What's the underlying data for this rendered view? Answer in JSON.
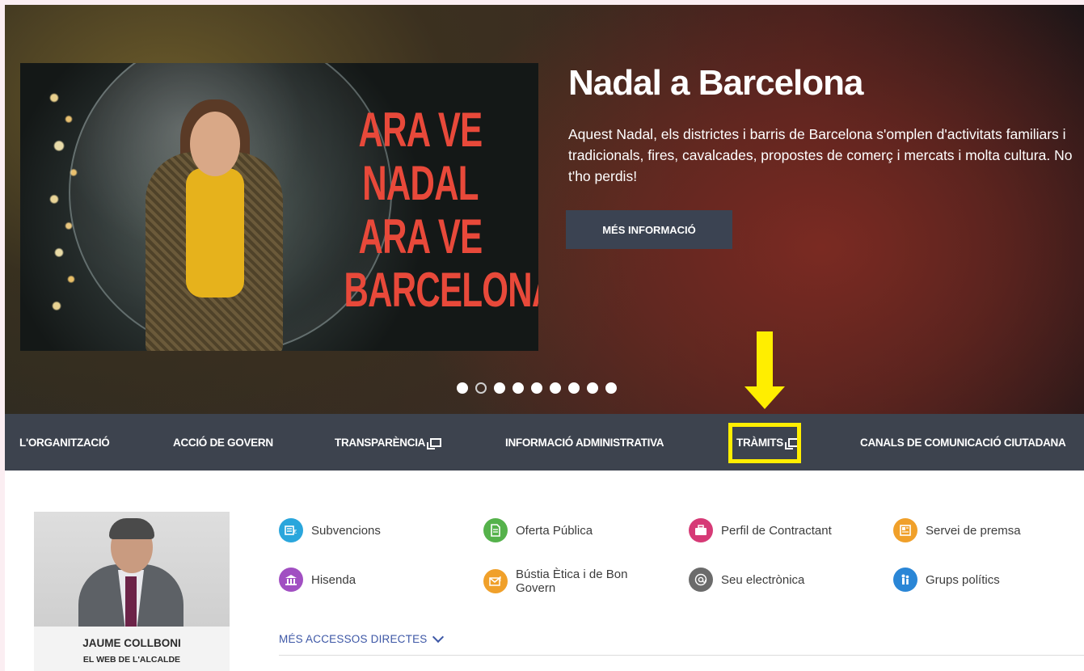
{
  "hero": {
    "title": "Nadal a Barcelona",
    "description": "Aquest Nadal, els districtes i barris de Barcelona s'omplen d'activitats familiars i tradicionals, fires, cavalcades, propostes de comerç i mercats i molta cultura. No t'ho perdis!",
    "button_label": "MÉS INFORMACIÓ",
    "slogan_lines": [
      "ARA VE",
      "NADAL",
      "ARA VE",
      "BARCELONA"
    ],
    "carousel": {
      "total": 9,
      "active_index": 1
    }
  },
  "nav": {
    "items": [
      {
        "label": "L'ORGANITZACIÓ",
        "external": false
      },
      {
        "label": "ACCIÓ DE GOVERN",
        "external": false
      },
      {
        "label": "TRANSPARÈNCIA",
        "external": true
      },
      {
        "label": "INFORMACIÓ ADMINISTRATIVA",
        "external": false
      },
      {
        "label": "TRÀMITS",
        "external": true,
        "highlighted": true
      },
      {
        "label": "CANALS DE COMUNICACIÓ CIUTADANA",
        "external": false
      }
    ]
  },
  "annotation": {
    "color": "#ffee00"
  },
  "mayor": {
    "name": "JAUME COLLBONI",
    "subtitle": "EL WEB DE L'ALCALDE"
  },
  "quick_links": [
    {
      "label": "Subvencions",
      "icon": "euro-document-icon",
      "color": "#2aa6dc"
    },
    {
      "label": "Oferta Pública",
      "icon": "document-icon",
      "color": "#55b24b"
    },
    {
      "label": "Perfil de Contractant",
      "icon": "briefcase-icon",
      "color": "#d63a76"
    },
    {
      "label": "Servei de premsa",
      "icon": "newspaper-icon",
      "color": "#f0a02a"
    },
    {
      "label": "Hisenda",
      "icon": "bank-icon",
      "color": "#a14fc2"
    },
    {
      "label": "Bústia Ètica i de Bon Govern",
      "icon": "mailbox-icon",
      "color": "#f0a02a"
    },
    {
      "label": "Seu electrònica",
      "icon": "at-sign-icon",
      "color": "#6b6b6b"
    },
    {
      "label": "Grups polítics",
      "icon": "people-icon",
      "color": "#2a86d6"
    }
  ],
  "more_links": {
    "label": "MÉS ACCESSOS DIRECTES"
  }
}
